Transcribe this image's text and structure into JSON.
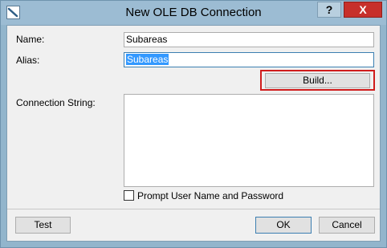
{
  "window": {
    "title": "New OLE DB Connection",
    "help_label": "?",
    "close_label": "X"
  },
  "form": {
    "name_label": "Name:",
    "name_value": "Subareas",
    "alias_label": "Alias:",
    "alias_value": "Subareas",
    "build_label": "Build...",
    "connection_string_label": "Connection String:",
    "connection_string_value": "",
    "prompt_label": "Prompt User Name and Password",
    "prompt_checked": false
  },
  "footer": {
    "test_label": "Test",
    "ok_label": "OK",
    "cancel_label": "Cancel"
  },
  "colors": {
    "title_bar": "#9cbcd3",
    "close_button": "#c7302b",
    "highlight": "#d01c1c",
    "selection": "#3399ff"
  }
}
